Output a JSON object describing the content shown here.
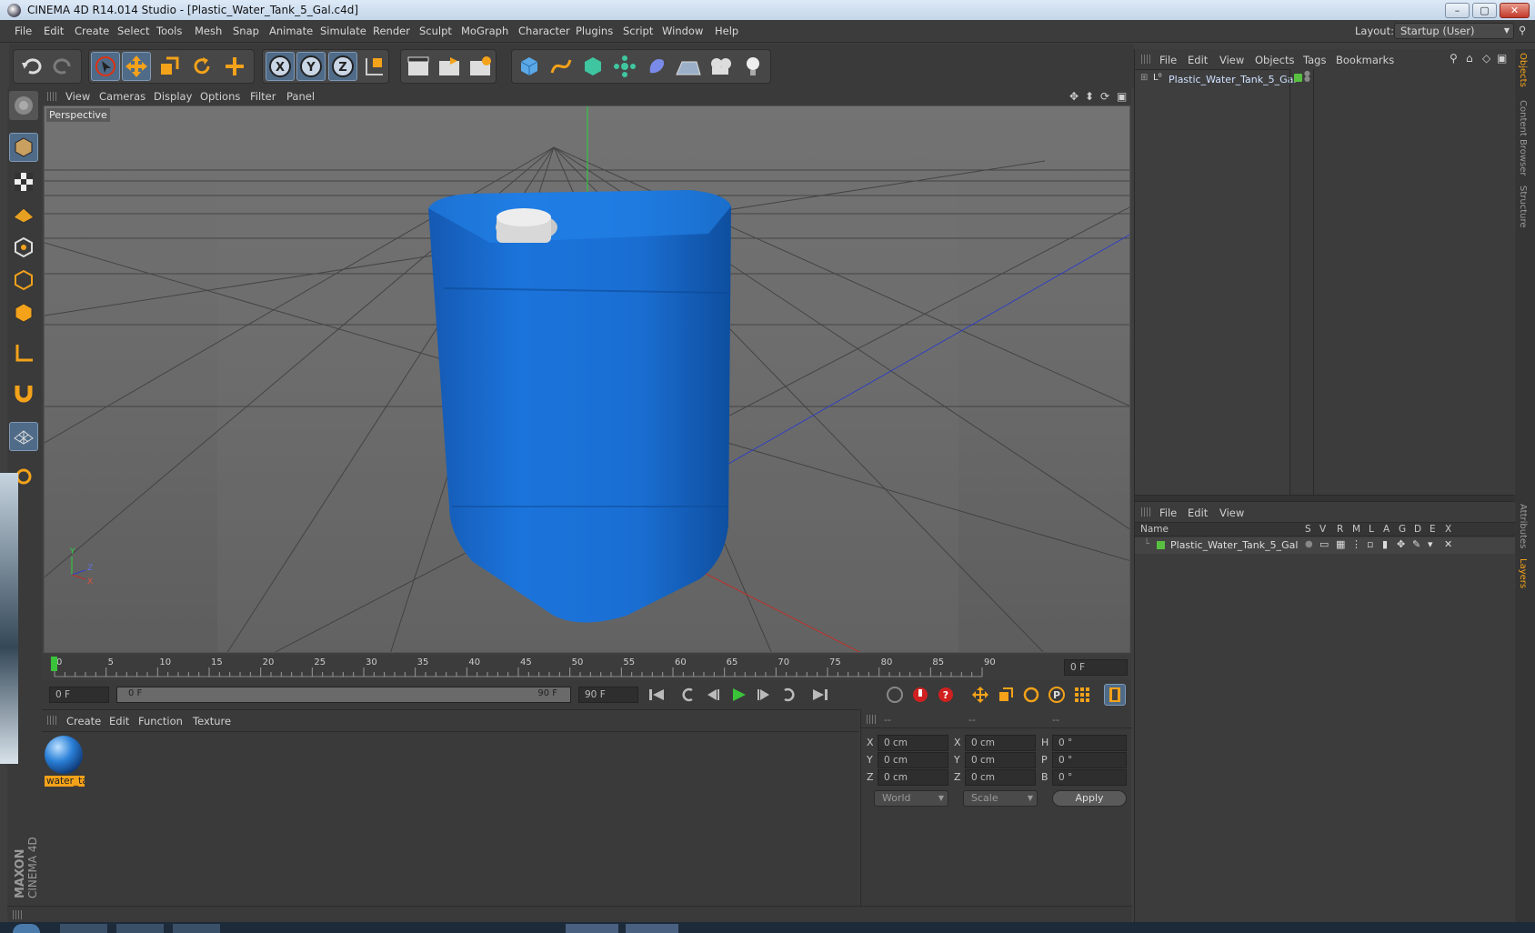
{
  "window": {
    "title": "CINEMA 4D R14.014 Studio - [Plastic_Water_Tank_5_Gal.c4d]",
    "min": "–",
    "max": "▢",
    "close": "✕"
  },
  "menubar": {
    "items": [
      "File",
      "Edit",
      "Create",
      "Select",
      "Tools",
      "Mesh",
      "Snap",
      "Animate",
      "Simulate",
      "Render",
      "Sculpt",
      "MoGraph",
      "Character",
      "Plugins",
      "Script",
      "Window",
      "Help"
    ],
    "layout_label": "Layout:",
    "layout_value": "Startup (User)"
  },
  "viewport": {
    "menu": [
      "View",
      "Cameras",
      "Display",
      "Options",
      "Filter",
      "Panel"
    ],
    "label": "Perspective",
    "axis_y": "Y",
    "axis_z": "Z",
    "axis_x": "X"
  },
  "timeline": {
    "ticks": [
      "0",
      "5",
      "10",
      "15",
      "20",
      "25",
      "30",
      "35",
      "40",
      "45",
      "50",
      "55",
      "60",
      "65",
      "70",
      "75",
      "80",
      "85",
      "90"
    ],
    "end_field": "0 F",
    "current_frame": "0 F",
    "range_start": "0 F",
    "range_end": "90 F",
    "max_frame": "90 F",
    "range_fill": 1.0
  },
  "materials": {
    "menu": [
      "Create",
      "Edit",
      "Function",
      "Texture"
    ],
    "items": [
      {
        "name": "water_ta"
      }
    ]
  },
  "coords": {
    "header": [
      "--",
      "--",
      "--"
    ],
    "rows": [
      {
        "a": "X",
        "v1": "0 cm",
        "b": "X",
        "v2": "0 cm",
        "c": "H",
        "v3": "0 °"
      },
      {
        "a": "Y",
        "v1": "0 cm",
        "b": "Y",
        "v2": "0 cm",
        "c": "P",
        "v3": "0 °"
      },
      {
        "a": "Z",
        "v1": "0 cm",
        "b": "Z",
        "v2": "0 cm",
        "c": "B",
        "v3": "0 °"
      }
    ],
    "world": "World",
    "scale": "Scale",
    "apply": "Apply"
  },
  "objects": {
    "menu": [
      "File",
      "Edit",
      "View",
      "Objects",
      "Tags",
      "Bookmarks"
    ],
    "items": [
      {
        "name": "Plastic_Water_Tank_5_Gal",
        "color": "#58c040"
      }
    ]
  },
  "layers": {
    "menu": [
      "File",
      "Edit",
      "View"
    ],
    "columns": [
      "Name",
      "S",
      "V",
      "R",
      "M",
      "L",
      "A",
      "G",
      "D",
      "E",
      "X"
    ],
    "items": [
      {
        "name": "Plastic_Water_Tank_5_Gal",
        "color": "#58c040"
      }
    ]
  },
  "side_tabs": [
    "Objects",
    "Content Browser",
    "Structure",
    "Attributes",
    "Layers"
  ],
  "brand": {
    "maxon": "MAXON",
    "product": "CINEMA 4D"
  },
  "colors": {
    "accent": "#f0a020",
    "object": "#1a6fd0",
    "selected_tool": "#4f6b88"
  }
}
